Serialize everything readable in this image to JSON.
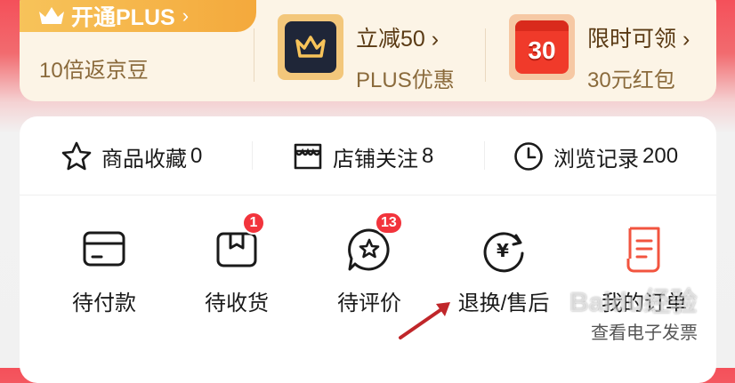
{
  "plus": {
    "tag_label": "开通PLUS",
    "tag_chevron": "›",
    "subtitle": "10倍返京豆",
    "promos": [
      {
        "title": "立减50 ›",
        "subtitle": "PLUS优惠",
        "icon": "crown-icon"
      },
      {
        "title": "限时可领 ›",
        "subtitle": "30元红包",
        "icon": "calendar-30-icon",
        "icon_text": "30"
      }
    ]
  },
  "stats": [
    {
      "label": "商品收藏",
      "count": "0",
      "icon": "star-icon"
    },
    {
      "label": "店铺关注",
      "count": "8",
      "icon": "store-icon"
    },
    {
      "label": "浏览记录",
      "count": "200",
      "icon": "clock-icon"
    }
  ],
  "orders": [
    {
      "label": "待付款",
      "icon": "wallet-card-icon"
    },
    {
      "label": "待收货",
      "icon": "package-box-icon",
      "badge": "1"
    },
    {
      "label": "待评价",
      "icon": "review-star-bubble-icon",
      "badge": "13"
    },
    {
      "label": "退换/售后",
      "icon": "refund-yen-icon"
    },
    {
      "label": "我的订单",
      "sublabel": "查看电子发票",
      "icon": "order-list-icon"
    }
  ],
  "watermark": "Baidu经验",
  "colors": {
    "brand_red": "#f4505a",
    "plus_gold": "#f4a93c",
    "badge_red": "#f2343c",
    "arrow_red": "#c0262a"
  }
}
